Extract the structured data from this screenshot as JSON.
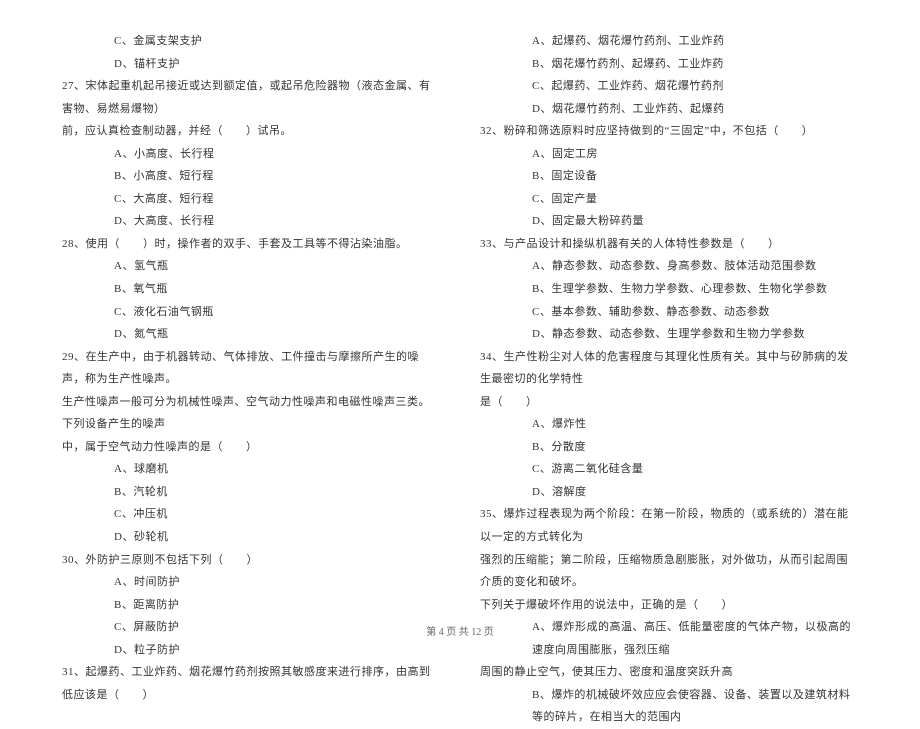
{
  "left": {
    "opt_c_27pre": "C、金属支架支护",
    "opt_d_27pre": "D、锚杆支护",
    "q27_l1": "27、宋体起重机起吊接近或达到额定值，或起吊危险器物（液态金属、有害物、易燃易爆物）",
    "q27_l2": "前，应认真检查制动器，并经（　　）试吊。",
    "q27_a": "A、小高度、长行程",
    "q27_b": "B、小高度、短行程",
    "q27_c": "C、大高度、短行程",
    "q27_d": "D、大高度、长行程",
    "q28": "28、使用（　　）时，操作者的双手、手套及工具等不得沾染油脂。",
    "q28_a": "A、氢气瓶",
    "q28_b": "B、氧气瓶",
    "q28_c": "C、液化石油气钢瓶",
    "q28_d": "D、氮气瓶",
    "q29_l1": "29、在生产中，由于机器转动、气体排放、工件撞击与摩擦所产生的噪声，称为生产性噪声。",
    "q29_l2": "生产性噪声一般可分为机械性噪声、空气动力性噪声和电磁性噪声三类。下列设备产生的噪声",
    "q29_l3": "中，属于空气动力性噪声的是（　　）",
    "q29_a": "A、球磨机",
    "q29_b": "B、汽轮机",
    "q29_c": "C、冲压机",
    "q29_d": "D、砂轮机",
    "q30": "30、外防护三原则不包括下列（　　）",
    "q30_a": "A、时间防护",
    "q30_b": "B、距离防护",
    "q30_c": "C、屏蔽防护",
    "q30_d": "D、粒子防护",
    "q31": "31、起爆药、工业炸药、烟花爆竹药剂按照其敏感度来进行排序，由高到低应该是（　　）"
  },
  "right": {
    "q31_a": "A、起爆药、烟花爆竹药剂、工业炸药",
    "q31_b": "B、烟花爆竹药剂、起爆药、工业炸药",
    "q31_c": "C、起爆药、工业炸药、烟花爆竹药剂",
    "q31_d": "D、烟花爆竹药剂、工业炸药、起爆药",
    "q32": "32、粉碎和筛选原料时应坚持做到的“三固定”中，不包括（　　）",
    "q32_a": "A、固定工房",
    "q32_b": "B、固定设备",
    "q32_c": "C、固定产量",
    "q32_d": "D、固定最大粉碎药量",
    "q33": "33、与产品设计和操纵机器有关的人体特性参数是（　　）",
    "q33_a": "A、静态参数、动态参数、身高参数、肢体活动范围参数",
    "q33_b": "B、生理学参数、生物力学参数、心理参数、生物化学参数",
    "q33_c": "C、基本参数、辅助参数、静态参数、动态参数",
    "q33_d": "D、静态参数、动态参数、生理学参数和生物力学参数",
    "q34_l1": "34、生产性粉尘对人体的危害程度与其理化性质有关。其中与矽肺病的发生最密切的化学特性",
    "q34_l2": "是（　　）",
    "q34_a": "A、爆炸性",
    "q34_b": "B、分散度",
    "q34_c": "C、游离二氧化硅含量",
    "q34_d": "D、溶解度",
    "q35_l1": "35、爆炸过程表现为两个阶段：在第一阶段，物质的（或系统的）潜在能以一定的方式转化为",
    "q35_l2": "强烈的压缩能；第二阶段，压缩物质急剧膨胀，对外做功，从而引起周围介质的变化和破坏。",
    "q35_l3": "下列关于爆破坏作用的说法中，正确的是（　　）",
    "q35_a_l1": "A、爆炸形成的高温、高压、低能量密度的气体产物，以极高的速度向周围膨胀，强烈压缩",
    "q35_a_l2": "周围的静止空气，使其压力、密度和温度突跃升高",
    "q35_b_l1": "B、爆炸的机械破坏效应应会使容器、设备、装置以及建筑材料等的碎片，在相当大的范围内"
  },
  "footer": "第 4 页 共 12 页"
}
